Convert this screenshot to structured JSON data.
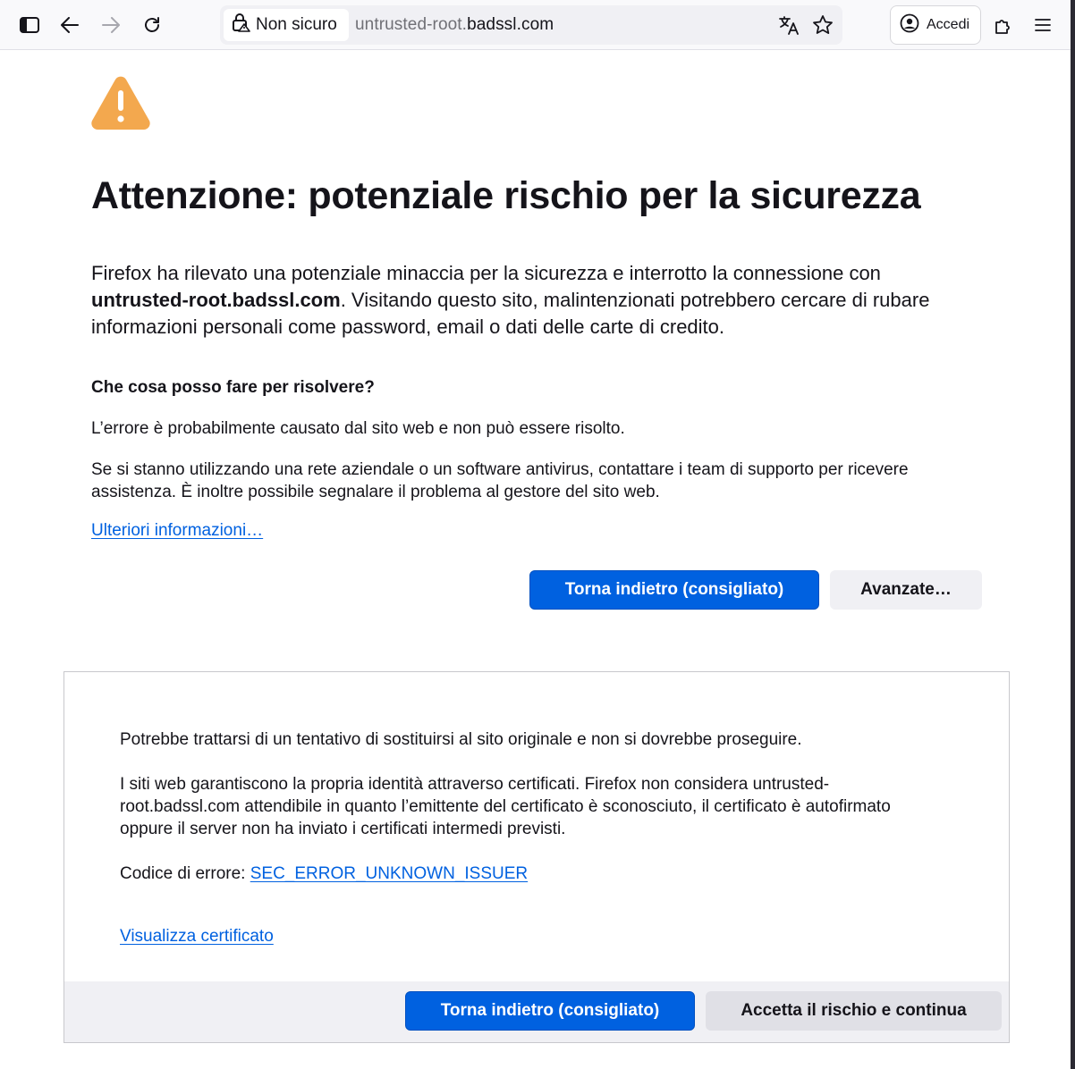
{
  "toolbar": {
    "identity_label": "Non sicuro",
    "url_prefix": "untrusted-root.",
    "url_host": "badssl.com",
    "signin_label": "Accedi"
  },
  "page": {
    "title": "Attenzione: potenziale rischio per la sicurezza",
    "intro_before": "Firefox ha rilevato una potenziale minaccia per la sicurezza e interrotto la connessione con ",
    "intro_host": "untrusted-root.badssl.com",
    "intro_after": ". Visitando questo sito, malintenzionati potrebbero cercare di rubare informazioni personali come password, email o dati delle carte di credito.",
    "what_heading": "Che cosa posso fare per risolvere?",
    "what_p1": "L’errore è probabilmente causato dal sito web e non può essere risolto.",
    "what_p2": "Se si stanno utilizzando una rete aziendale o un software antivirus, contattare i team di supporto per ricevere assistenza. È inoltre possibile segnalare il problema al gestore del sito web.",
    "learn_more": "Ulteriori informazioni…",
    "go_back_button": "Torna indietro (consigliato)",
    "advanced_button": "Avanzate…"
  },
  "advanced": {
    "p1": "Potrebbe trattarsi di un tentativo di sostituirsi al sito originale e non si dovrebbe proseguire.",
    "p2": "I siti web garantiscono la propria identità attraverso certificati. Firefox non considera untrusted-root.badssl.com attendibile in quanto l’emittente del certificato è sconosciuto, il certificato è autofirmato oppure il server non ha inviato i certificati intermedi previsti.",
    "error_code_label": "Codice di errore: ",
    "error_code": "SEC_ERROR_UNKNOWN_ISSUER",
    "view_certificate": "Visualizza certificato",
    "go_back_button": "Torna indietro (consigliato)",
    "accept_button": "Accetta il rischio e continua"
  },
  "icons": {
    "sidebar": "sidebar-icon",
    "back": "back-arrow-icon",
    "forward": "forward-arrow-icon",
    "reload": "reload-icon",
    "insecure": "insecure-lock-icon",
    "translate": "translate-icon",
    "bookmark": "star-icon",
    "account": "account-icon",
    "extensions": "puzzle-icon",
    "menu": "hamburger-menu-icon",
    "warning": "warning-triangle-icon"
  },
  "colors": {
    "accent": "#0061e0",
    "warning": "#f3a84e",
    "text": "#15141a"
  }
}
